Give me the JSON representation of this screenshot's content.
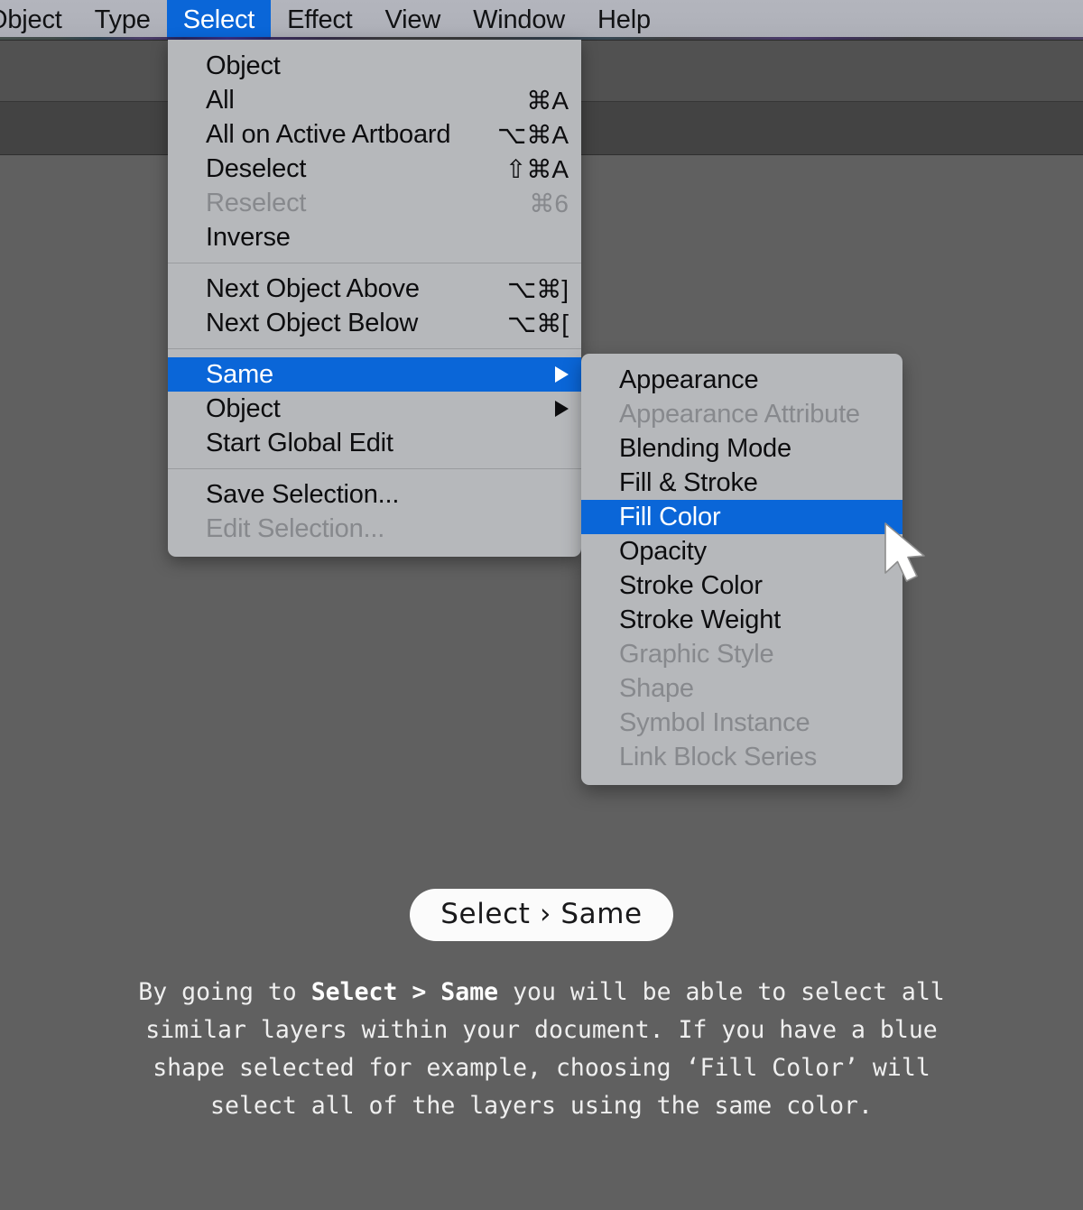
{
  "menubar": {
    "items": [
      {
        "label": "Object",
        "active": false
      },
      {
        "label": "Type",
        "active": false
      },
      {
        "label": "Select",
        "active": true
      },
      {
        "label": "Effect",
        "active": false
      },
      {
        "label": "View",
        "active": false
      },
      {
        "label": "Window",
        "active": false
      },
      {
        "label": "Help",
        "active": false
      }
    ]
  },
  "select_menu": {
    "groups": [
      {
        "items": [
          {
            "label": "Object",
            "shortcut": "",
            "state": "normal",
            "submenu": false
          },
          {
            "label": "All",
            "shortcut": "⌘A",
            "state": "normal",
            "submenu": false
          },
          {
            "label": "All on Active Artboard",
            "shortcut": "⌥⌘A",
            "state": "normal",
            "submenu": false
          },
          {
            "label": "Deselect",
            "shortcut": "⇧⌘A",
            "state": "normal",
            "submenu": false
          },
          {
            "label": "Reselect",
            "shortcut": "⌘6",
            "state": "disabled",
            "submenu": false
          },
          {
            "label": "Inverse",
            "shortcut": "",
            "state": "normal",
            "submenu": false
          }
        ]
      },
      {
        "items": [
          {
            "label": "Next Object Above",
            "shortcut": "⌥⌘]",
            "state": "normal",
            "submenu": false
          },
          {
            "label": "Next Object Below",
            "shortcut": "⌥⌘[",
            "state": "normal",
            "submenu": false
          }
        ]
      },
      {
        "items": [
          {
            "label": "Same",
            "shortcut": "",
            "state": "highlight",
            "submenu": true
          },
          {
            "label": "Object",
            "shortcut": "",
            "state": "normal",
            "submenu": true
          },
          {
            "label": "Start Global Edit",
            "shortcut": "",
            "state": "normal",
            "submenu": false
          }
        ]
      },
      {
        "items": [
          {
            "label": "Save Selection...",
            "shortcut": "",
            "state": "normal",
            "submenu": false
          },
          {
            "label": "Edit Selection...",
            "shortcut": "",
            "state": "disabled",
            "submenu": false
          }
        ]
      }
    ]
  },
  "same_submenu": {
    "items": [
      {
        "label": "Appearance",
        "state": "normal"
      },
      {
        "label": "Appearance Attribute",
        "state": "disabled"
      },
      {
        "label": "Blending Mode",
        "state": "normal"
      },
      {
        "label": "Fill & Stroke",
        "state": "normal"
      },
      {
        "label": "Fill Color",
        "state": "highlight"
      },
      {
        "label": "Opacity",
        "state": "normal"
      },
      {
        "label": "Stroke Color",
        "state": "normal"
      },
      {
        "label": "Stroke Weight",
        "state": "normal"
      },
      {
        "label": "Graphic Style",
        "state": "disabled"
      },
      {
        "label": "Shape",
        "state": "disabled"
      },
      {
        "label": "Symbol Instance",
        "state": "disabled"
      },
      {
        "label": "Link Block Series",
        "state": "disabled"
      }
    ]
  },
  "caption": {
    "pill_label": "Select › Same",
    "body_parts": [
      {
        "text": "By going to ",
        "bold": false
      },
      {
        "text": "Select > Same",
        "bold": true
      },
      {
        "text": " you will be able to select all similar layers within your document. If you have a blue shape selected for example, choosing ‘Fill Color’ will select all of the layers using the same color.",
        "bold": false
      }
    ]
  },
  "colors": {
    "accent_blue": "#0a66d8",
    "menu_background": "#b6b8bb",
    "canvas_background": "#606060",
    "menubar_background": "#b1b3bb",
    "pill_background": "#fbfbfb",
    "disabled_text": "#87898d"
  }
}
